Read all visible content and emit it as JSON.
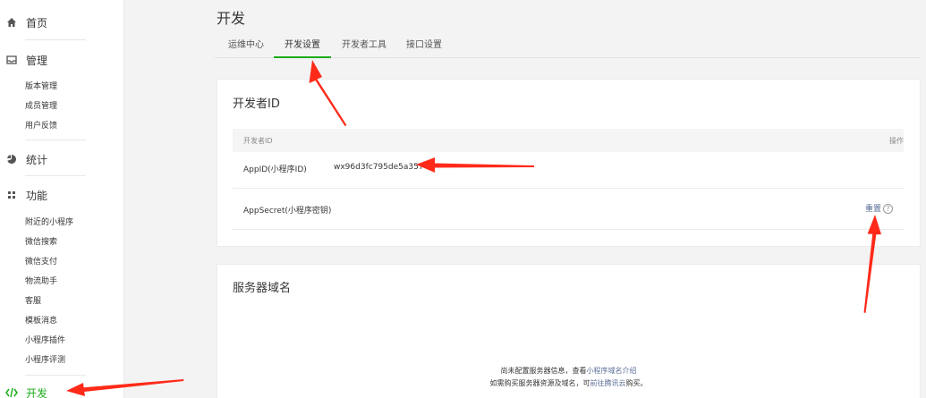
{
  "sidebar": {
    "home": "首页",
    "manage": {
      "label": "管理",
      "items": [
        "版本管理",
        "成员管理",
        "用户反馈"
      ]
    },
    "stats": "统计",
    "features": {
      "label": "功能",
      "items": [
        "附近的小程序",
        "微信搜索",
        "微信支付",
        "物流助手",
        "客服",
        "模板消息",
        "小程序插件",
        "小程序评测"
      ]
    },
    "develop": "开发"
  },
  "main": {
    "title": "开发",
    "tabs": [
      "运维中心",
      "开发设置",
      "开发者工具",
      "接口设置"
    ],
    "active_tab": "开发设置",
    "developer_id": {
      "title": "开发者ID",
      "col_id": "开发者ID",
      "col_action": "操作",
      "appid_label": "AppID(小程序ID)",
      "appid_value": "wx96d3fc795de5a357",
      "secret_label": "AppSecret(小程序密钥)",
      "reset": "重置"
    },
    "server": {
      "title": "服务器域名",
      "line1_prefix": "尚未配置服务器信息，查看",
      "line1_link": "小程序域名介绍",
      "line2_prefix": "如需购买服务器资源及域名，可",
      "line2_link": "前往腾讯云",
      "line2_suffix": "购买。"
    }
  },
  "colors": {
    "accent": "#1aad19",
    "link": "#576b95",
    "annotation": "#ff2a1a"
  }
}
